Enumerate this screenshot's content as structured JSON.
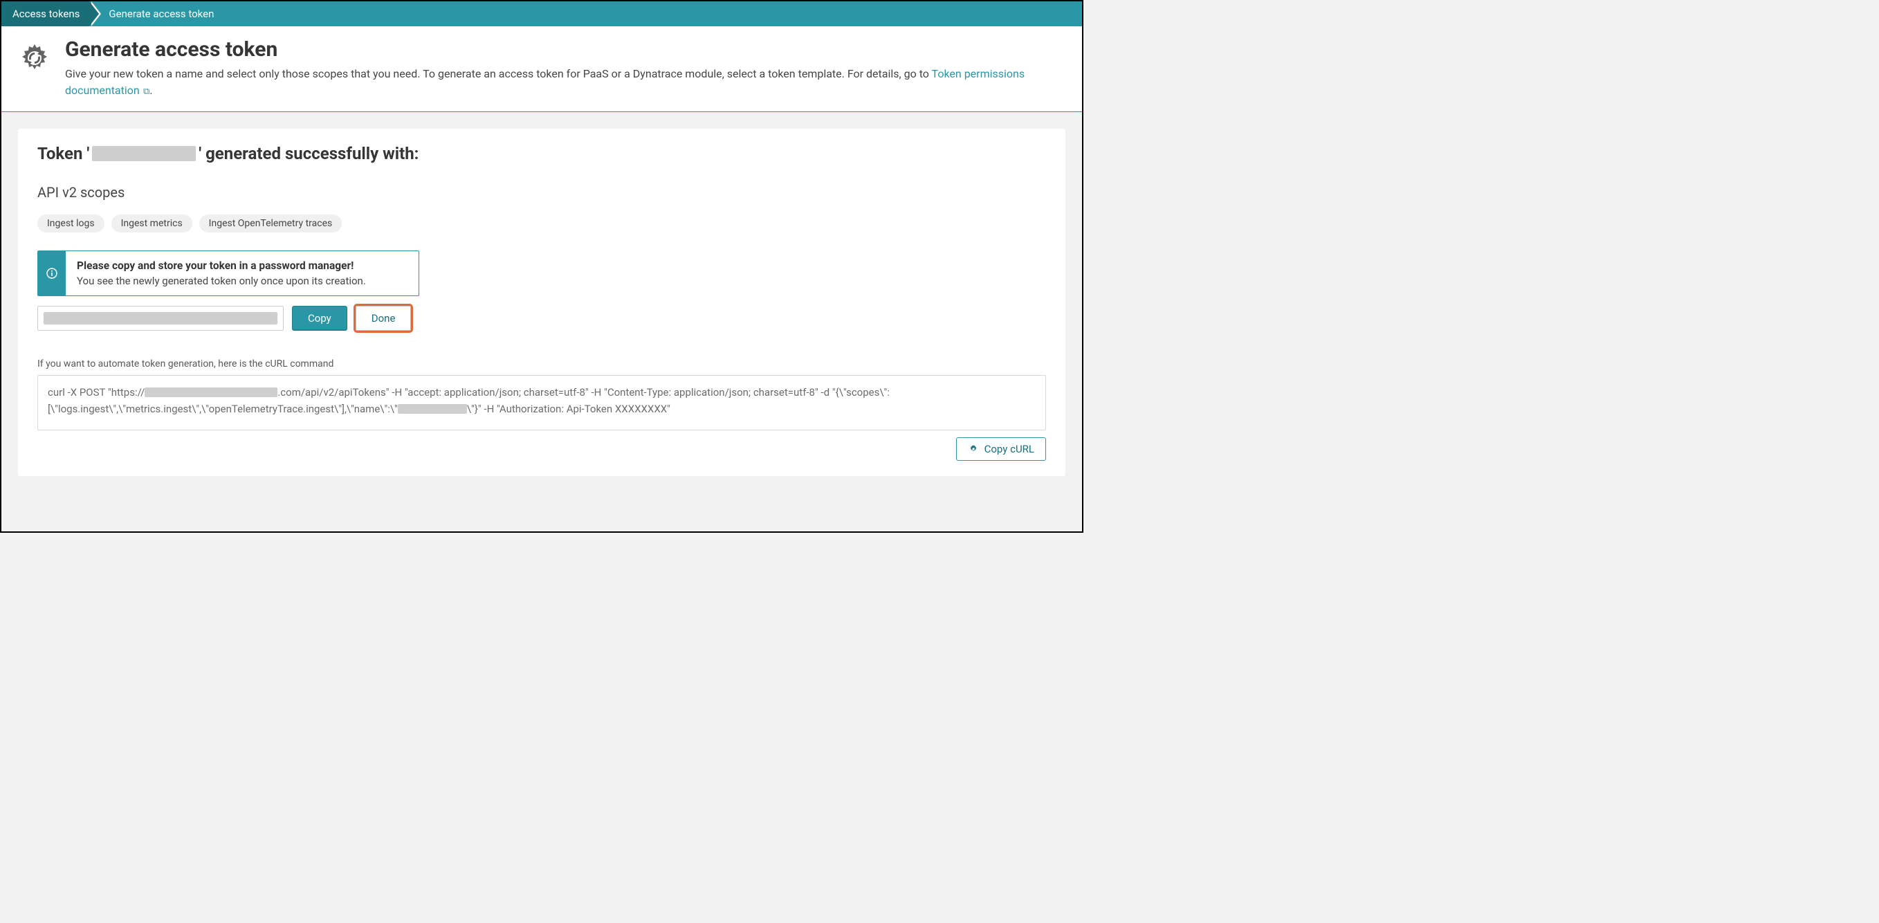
{
  "breadcrumb": {
    "item0": "Access tokens",
    "item1": "Generate access token"
  },
  "header": {
    "title": "Generate access token",
    "desc_prefix": "Give your new token a name and select only those scopes that you need. To generate an access token for PaaS or a Dynatrace module, select a token template. For details, go to ",
    "link_text": "Token permissions documentation",
    "desc_suffix": "."
  },
  "success": {
    "prefix": "Token '",
    "suffix": "' generated successfully with:"
  },
  "scopes": {
    "heading": "API v2 scopes",
    "items": [
      "Ingest logs",
      "Ingest metrics",
      "Ingest OpenTelemetry traces"
    ]
  },
  "info": {
    "bold": "Please copy and store your token in a password manager!",
    "sub": "You see the newly generated token only once upon its creation."
  },
  "buttons": {
    "copy": "Copy",
    "done": "Done",
    "copy_curl": "Copy cURL"
  },
  "curl": {
    "label": "If you want to automate token generation, here is the cURL command",
    "seg1": "curl -X POST \"https://",
    "seg2": ".com/api/v2/apiTokens\" -H \"accept: application/json; charset=utf-8\" -H \"Content-Type: application/json; charset=utf-8\" -d \"{\\\"scopes\\\":",
    "seg3": "[\\\"logs.ingest\\\",\\\"metrics.ingest\\\",\\\"openTelemetryTrace.ingest\\\"],\\\"name\\\":\\\"",
    "seg4": "\\\"}\" -H \"Authorization: Api-Token XXXXXXXX\""
  }
}
